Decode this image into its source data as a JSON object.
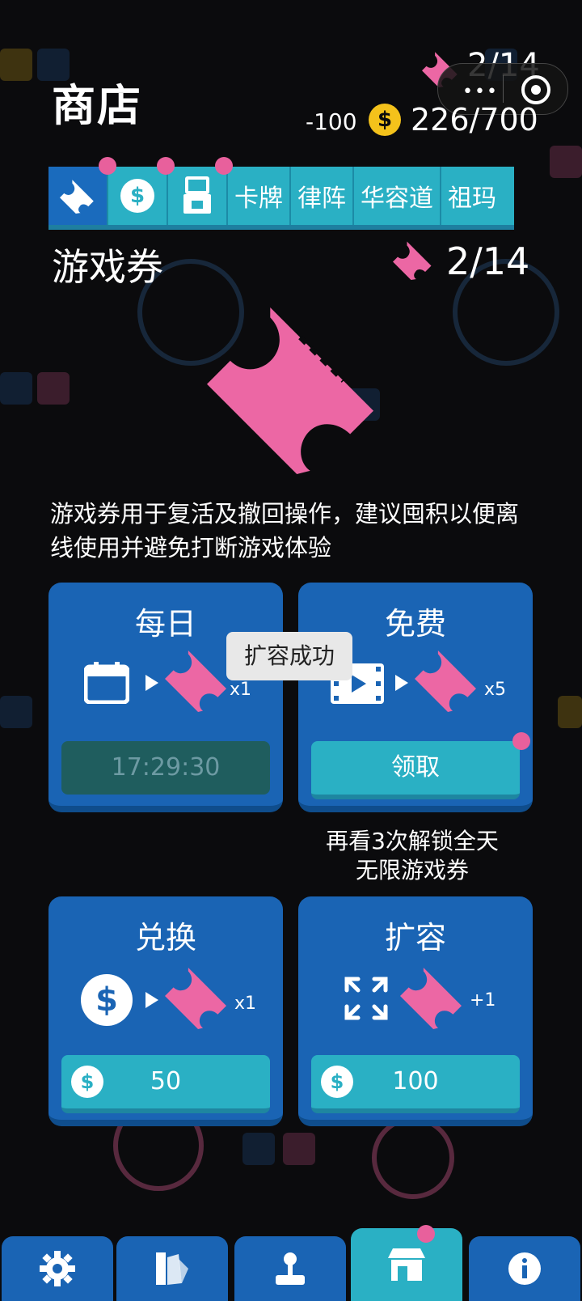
{
  "header": {
    "title": "商店",
    "ticket_count": "2/14",
    "coin_delta": "-100",
    "coin_symbol": "$",
    "coin_total": "226/700"
  },
  "capsule": {
    "more_icon": "more-dots-icon",
    "close_icon": "target-icon"
  },
  "tabs": [
    {
      "label": "",
      "icon": "ticket-icon",
      "active": true
    },
    {
      "label": "",
      "icon": "coin-icon"
    },
    {
      "label": "",
      "icon": "gashapon-icon"
    },
    {
      "label": "卡牌"
    },
    {
      "label": "律阵"
    },
    {
      "label": "华容道"
    },
    {
      "label": "祖玛"
    }
  ],
  "section": {
    "title": "游戏券",
    "count": "2/14",
    "description": "游戏券用于复活及撤回操作，建议囤积以便离线使用并避免打断游戏体验"
  },
  "cards": {
    "daily": {
      "title": "每日",
      "multiplier": "x1",
      "button": "17:29:30"
    },
    "free": {
      "title": "免费",
      "multiplier": "x5",
      "button": "领取"
    },
    "exchange": {
      "title": "兑换",
      "multiplier": "x1",
      "price": "50"
    },
    "expand": {
      "title": "扩容",
      "multiplier": "+1",
      "price": "100"
    }
  },
  "unlock_tip_line1": "再看3次解锁全天",
  "unlock_tip_line2": "无限游戏券",
  "toast": "扩容成功",
  "nav": [
    {
      "icon": "gear-icon"
    },
    {
      "icon": "palette-icon"
    },
    {
      "icon": "joystick-icon"
    },
    {
      "icon": "store-icon",
      "active": true
    },
    {
      "icon": "info-icon"
    }
  ],
  "colors": {
    "background": "#0b0b0d",
    "card_blue": "#1a64b4",
    "teal": "#2ab0c4",
    "ticket_pink": "#ec67a4",
    "coin_yellow": "#f4c21b",
    "notification_dot": "#e8609c"
  }
}
